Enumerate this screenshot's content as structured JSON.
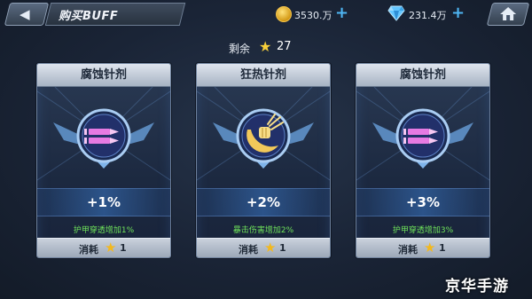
{
  "topbar": {
    "title": "购买BUFF",
    "coins": "3530.万",
    "gems": "231.4万",
    "back_icon": "back-arrow-icon",
    "home_icon": "home-icon",
    "plus_label": "+"
  },
  "remaining": {
    "label": "剩余",
    "count": "27"
  },
  "cards": [
    {
      "name": "腐蚀针剂",
      "bonus": "+1%",
      "desc": "护甲穿透增加1%",
      "cost_label": "消耗",
      "cost": "1",
      "icon": "bullet-emblem-icon"
    },
    {
      "name": "狂热针剂",
      "bonus": "+2%",
      "desc": "暴击伤害增加2%",
      "cost_label": "消耗",
      "cost": "1",
      "icon": "fist-emblem-icon"
    },
    {
      "name": "腐蚀针剂",
      "bonus": "+3%",
      "desc": "护甲穿透增加3%",
      "cost_label": "消耗",
      "cost": "1",
      "icon": "bullet-emblem-icon"
    }
  ],
  "colors": {
    "accent_blue": "#4fb6f4",
    "desc_green": "#6fe35a",
    "star_gold": "#f7cf3a"
  },
  "watermark": "京华手游"
}
